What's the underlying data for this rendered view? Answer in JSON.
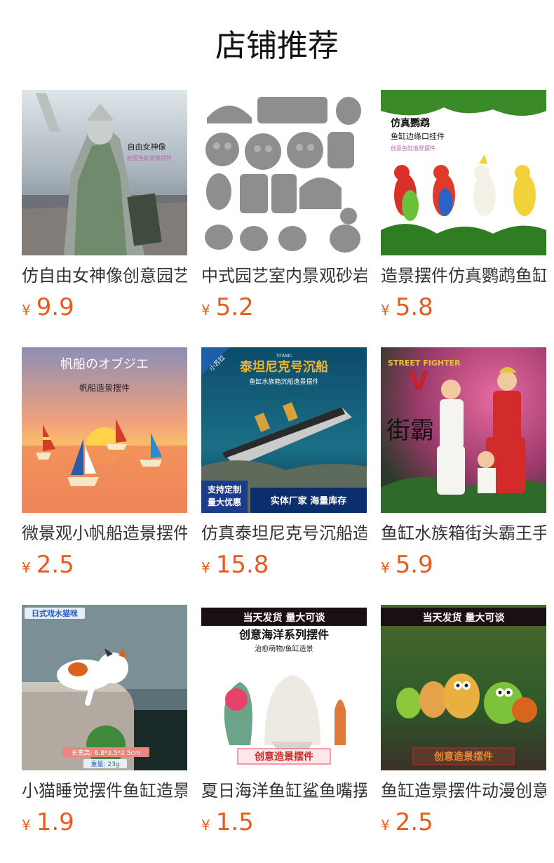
{
  "header": {
    "title": "店铺推荐"
  },
  "currency": "¥",
  "products": [
    {
      "name": "仿自由女神像创意园艺",
      "price": "9.9",
      "image": {
        "subject": "statue-of-liberty",
        "overlay_lines": [
          "自由女神像",
          "创意鱼缸造景摆件"
        ]
      }
    },
    {
      "name": "中式园艺室内景观砂岩",
      "price": "5.2",
      "image": {
        "subject": "chinese-stone-ornaments",
        "overlay_lines": []
      }
    },
    {
      "name": "造景摆件仿真鹦鹉鱼缸",
      "price": "5.8",
      "image": {
        "subject": "parrots",
        "overlay_lines": [
          "仿真鹦鹉",
          "鱼缸边缘口挂件",
          "创意鱼缸造景摆件"
        ]
      }
    },
    {
      "name": "微景观小帆船造景摆件",
      "price": "2.5",
      "image": {
        "subject": "sailboats",
        "overlay_lines": [
          "帆船のオブジエ",
          "帆船造景摆件"
        ]
      }
    },
    {
      "name": "仿真泰坦尼克号沉船造",
      "price": "15.8",
      "image": {
        "subject": "titanic-shipwreck",
        "overlay_lines": [
          "小苏拉",
          "TITANIC",
          "泰坦尼克号沉船",
          "鱼缸水族箱沉船造景摆件",
          "支持定制",
          "量大优惠",
          "实体厂家 海量库存"
        ]
      }
    },
    {
      "name": "鱼缸水族箱街头霸王手",
      "price": "5.9",
      "image": {
        "subject": "street-fighter-figures",
        "overlay_lines": [
          "STREET FIGHTER",
          "V",
          "街霸"
        ]
      }
    },
    {
      "name": "小猫睡觉摆件鱼缸造景",
      "price": "1.9",
      "image": {
        "subject": "sleeping-cat",
        "overlay_lines": [
          "日式戏水猫咪",
          "长宽高: 6.8*3.5*2.5cm",
          "重量: 23g"
        ]
      }
    },
    {
      "name": "夏日海洋鱼缸鲨鱼嘴摆",
      "price": "1.5",
      "image": {
        "subject": "ocean-ornaments",
        "overlay_lines": [
          "当天发货 量大可谈",
          "创意海洋系列摆件",
          "治愈萌物/鱼缸造景",
          "创意造景摆件"
        ]
      }
    },
    {
      "name": "鱼缸造景摆件动漫创意",
      "price": "2.5",
      "image": {
        "subject": "snail-figures",
        "overlay_lines": [
          "当天发货 量大可谈",
          "创意造景摆件"
        ]
      }
    }
  ]
}
